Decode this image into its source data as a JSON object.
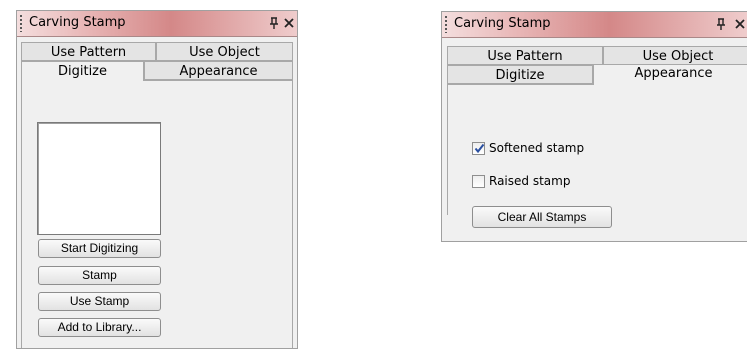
{
  "left_panel": {
    "title": "Carving Stamp",
    "tabs_row1": [
      "Use Pattern",
      "Use Object"
    ],
    "tabs_row2": [
      "Digitize",
      "Appearance"
    ],
    "active_tab": "Digitize",
    "buttons": {
      "start_digitizing": "Start Digitizing",
      "stamp": "Stamp",
      "use_stamp": "Use Stamp",
      "add_to_library": "Add to Library..."
    }
  },
  "right_panel": {
    "title": "Carving Stamp",
    "tabs_row1": [
      "Use Pattern",
      "Use Object"
    ],
    "tabs_row2": [
      "Digitize",
      "Appearance"
    ],
    "active_tab": "Appearance",
    "options": {
      "softened_label": "Softened stamp",
      "softened_checked": true,
      "raised_label": "Raised stamp",
      "raised_checked": false
    },
    "clear_button": "Clear All Stamps"
  },
  "icons": {
    "pin": "pin-icon",
    "close": "close-icon",
    "check": "checkmark-icon"
  },
  "colors": {
    "title_gradient": "#d48888",
    "check_color": "#2a4fa0"
  }
}
